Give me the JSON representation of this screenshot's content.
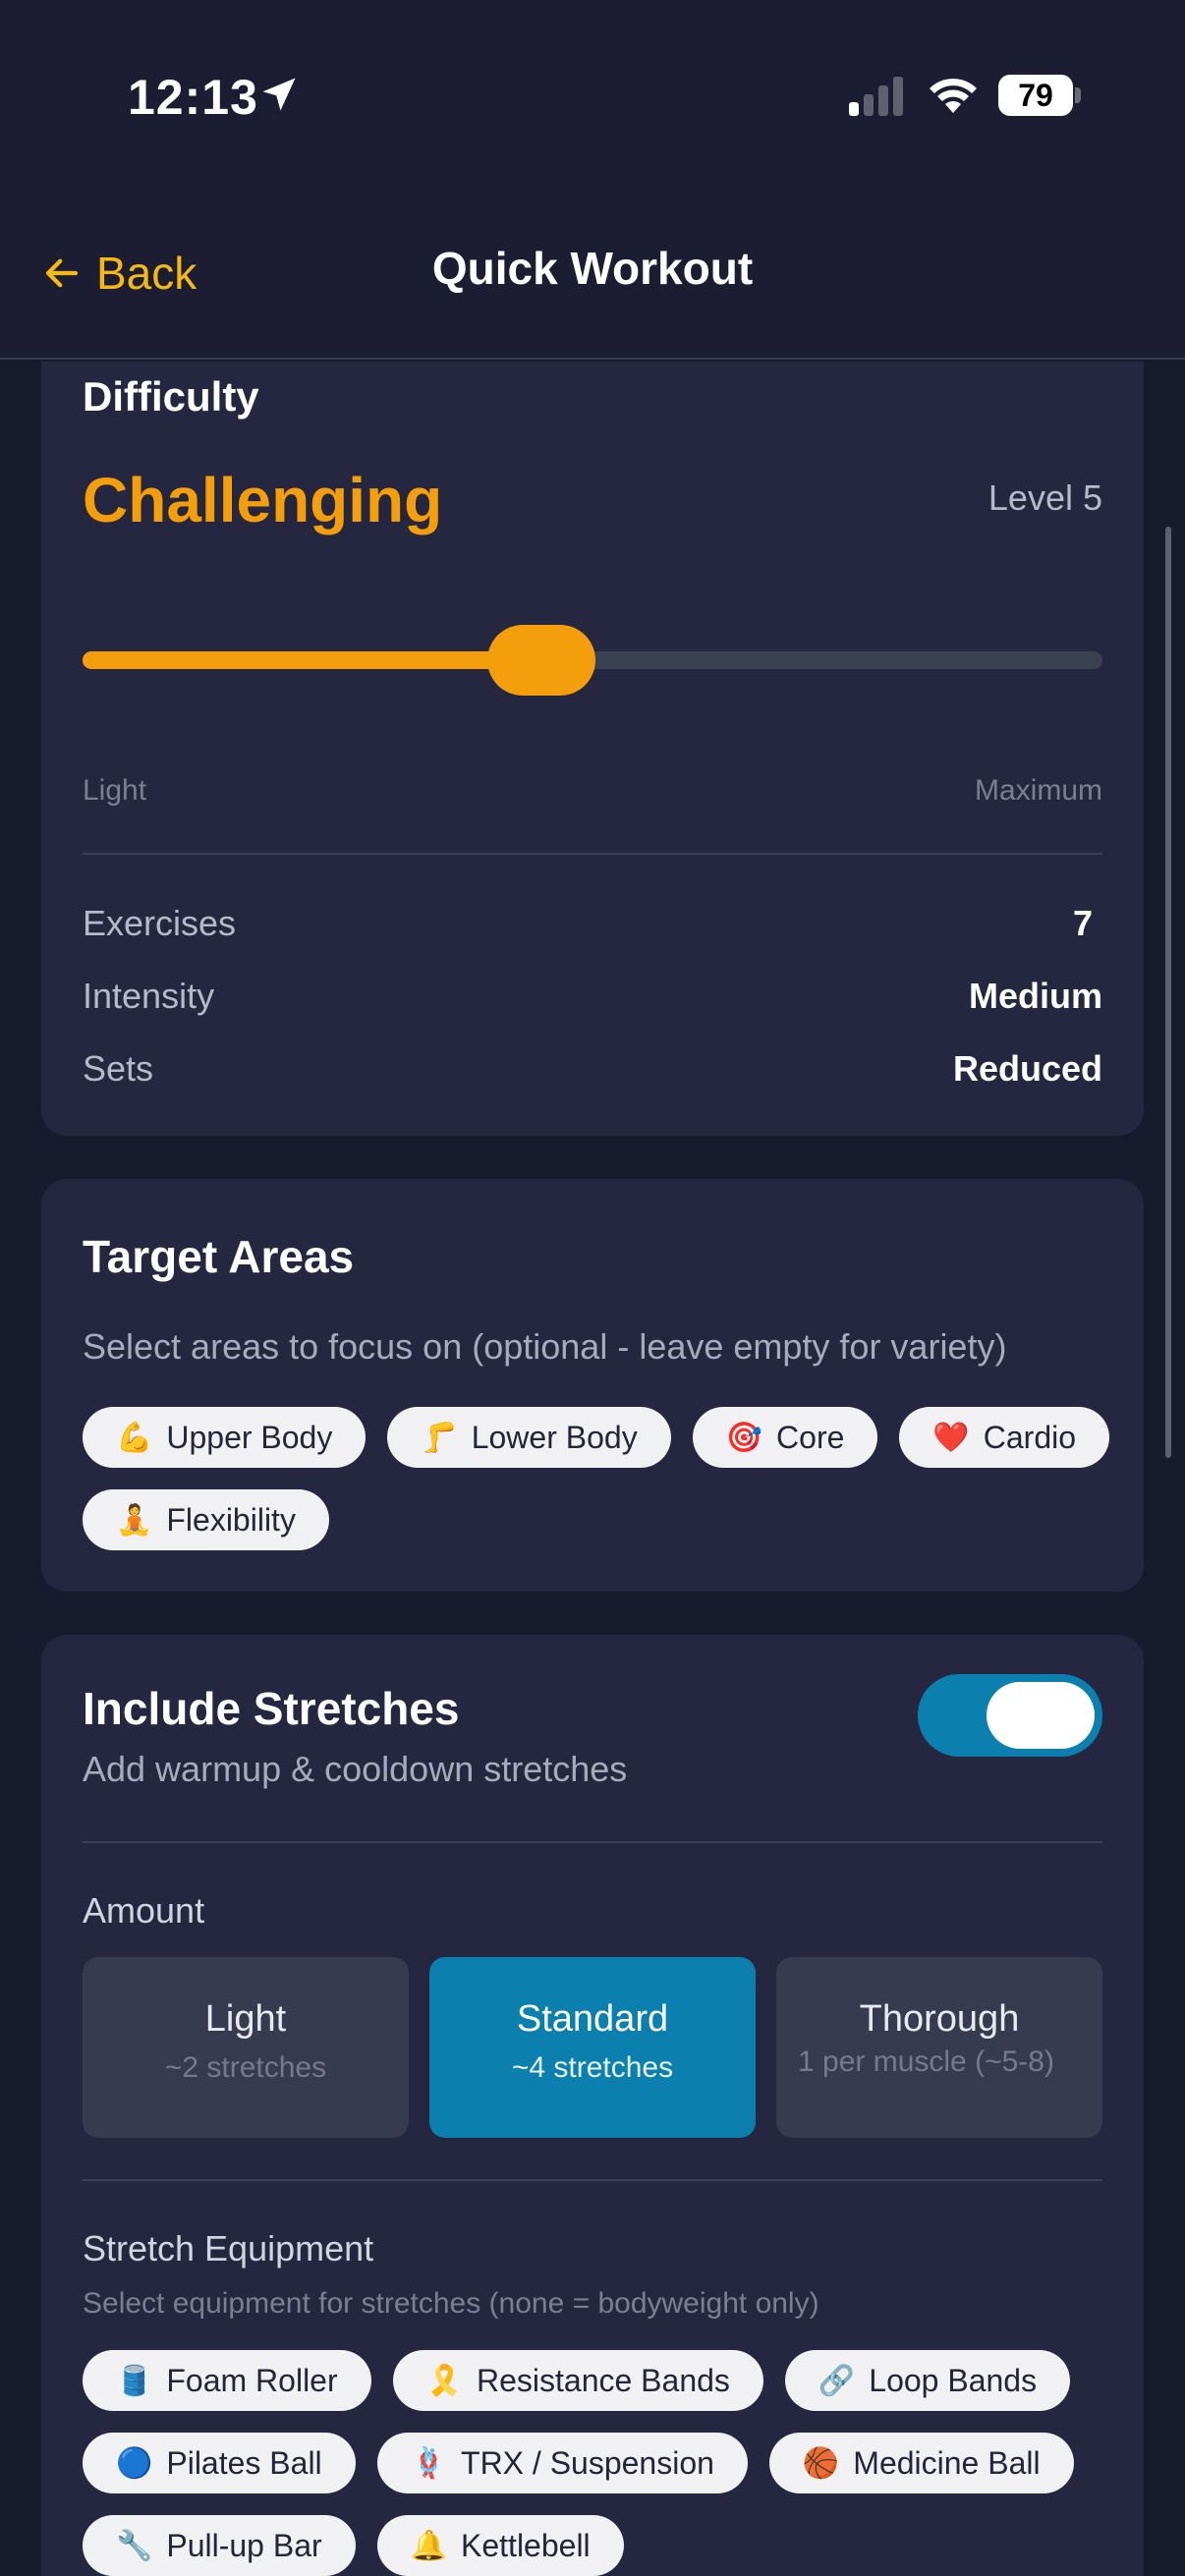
{
  "status": {
    "time": "12:13",
    "battery": "79"
  },
  "nav": {
    "back_label": "Back",
    "title": "Quick Workout"
  },
  "difficulty": {
    "heading": "Difficulty",
    "value": "Challenging",
    "level": "Level 5",
    "slider_fraction": 0.45,
    "range_min_label": "Light",
    "range_max_label": "Maximum",
    "stats": [
      {
        "key": "Exercises",
        "value": "7"
      },
      {
        "key": "Intensity",
        "value": "Medium"
      },
      {
        "key": "Sets",
        "value": "Reduced"
      }
    ]
  },
  "target": {
    "heading": "Target Areas",
    "subtitle": "Select areas to focus on (optional - leave empty for variety)",
    "chips": [
      {
        "emoji": "💪",
        "label": "Upper Body"
      },
      {
        "emoji": "🦵",
        "label": "Lower Body"
      },
      {
        "emoji": "🎯",
        "label": "Core"
      },
      {
        "emoji": "❤️",
        "label": "Cardio"
      },
      {
        "emoji": "🧘",
        "label": "Flexibility"
      }
    ]
  },
  "stretches": {
    "heading": "Include Stretches",
    "subtitle": "Add warmup & cooldown stretches",
    "enabled": true,
    "amount_label": "Amount",
    "options": [
      {
        "title": "Light",
        "sub": "~2 stretches"
      },
      {
        "title": "Standard",
        "sub": "~4 stretches"
      },
      {
        "title": "Thorough",
        "sub": "1 per muscle (~5-8)"
      }
    ],
    "selected": "Standard",
    "equipment_heading": "Stretch Equipment",
    "equipment_sub": "Select equipment for stretches (none = bodyweight only)",
    "equipment": [
      {
        "emoji": "🛢️",
        "label": "Foam Roller"
      },
      {
        "emoji": "🎗️",
        "label": "Resistance Bands"
      },
      {
        "emoji": "🔗",
        "label": "Loop Bands"
      },
      {
        "emoji": "🔵",
        "label": "Pilates Ball"
      },
      {
        "emoji": "🪢",
        "label": "TRX / Suspension"
      },
      {
        "emoji": "🏀",
        "label": "Medicine Ball"
      },
      {
        "emoji": "🔧",
        "label": "Pull-up Bar"
      },
      {
        "emoji": "🔔",
        "label": "Kettlebell"
      }
    ]
  },
  "colors": {
    "accent": "#f59e0b",
    "toggle": "#0b7fae",
    "card": "#25263f",
    "background": "#181a2e"
  }
}
